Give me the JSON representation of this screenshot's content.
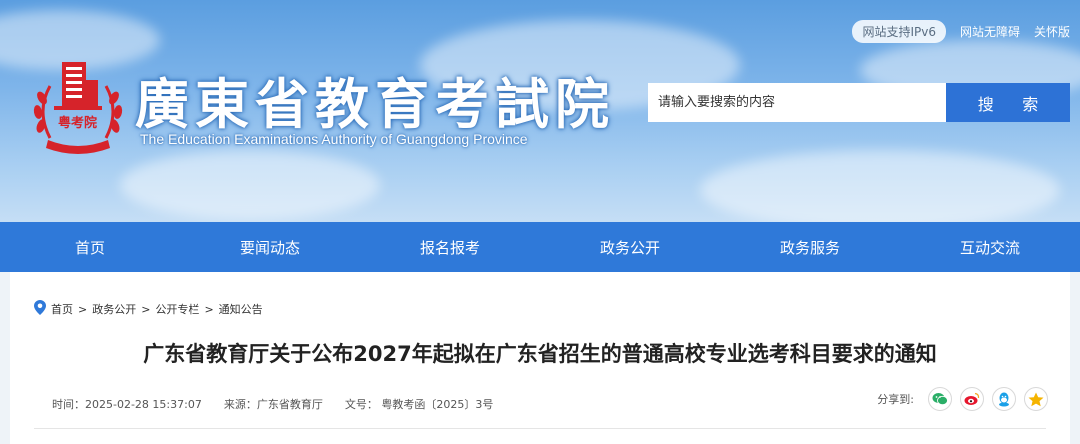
{
  "top_links": {
    "ipv6": "网站支持IPv6",
    "accessibility": "网站无障碍",
    "care_mode": "关怀版"
  },
  "header": {
    "title": "廣東省教育考試院",
    "subtitle": "The Education Examinations Authority of Guangdong Province",
    "logo_text": "粤考院",
    "logo_icon": "building-seal-icon"
  },
  "search": {
    "placeholder": "请输入要搜索的内容",
    "button_label": "搜  索"
  },
  "nav": {
    "items": [
      {
        "label": "首页"
      },
      {
        "label": "要闻动态"
      },
      {
        "label": "报名报考"
      },
      {
        "label": "政务公开"
      },
      {
        "label": "政务服务"
      },
      {
        "label": "互动交流"
      }
    ]
  },
  "breadcrumb": {
    "items": [
      "首页",
      "政务公开",
      "公开专栏",
      "通知公告"
    ],
    "separator": ">"
  },
  "article": {
    "title": "广东省教育厅关于公布2027年起拟在广东省招生的普通高校专业选考科目要求的通知",
    "time": "时间：2025-02-28 15:37:07",
    "source": "来源：广东省教育厅",
    "doc_no": "文号： 粤教考函〔2025〕3号"
  },
  "share": {
    "label": "分享到:",
    "icons": [
      "wechat-icon",
      "weibo-icon",
      "qq-icon",
      "qzone-icon"
    ]
  },
  "colors": {
    "nav_bg": "#2f79d9",
    "search_btn": "#2d72d6",
    "logo_red": "#d6232a",
    "wechat": "#2aae67",
    "weibo": "#e6162d",
    "qq": "#1aa0e8",
    "qzone": "#f5b400"
  }
}
